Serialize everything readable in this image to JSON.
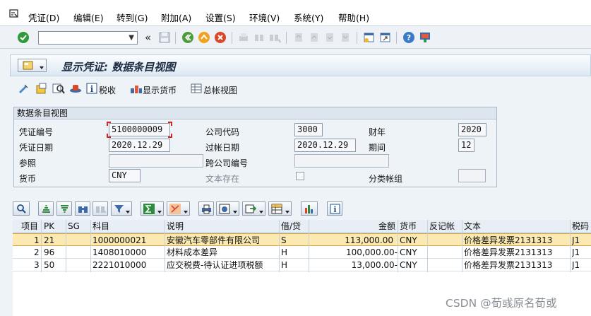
{
  "menu": {
    "items": [
      "凭证(D)",
      "编辑(E)",
      "转到(G)",
      "附加(A)",
      "设置(S)",
      "环境(V)",
      "系统(Y)",
      "帮助(H)"
    ]
  },
  "toolbar": {
    "command_field": "",
    "back_glyph": "«"
  },
  "screen": {
    "title": "显示凭证: 数据条目视图"
  },
  "app_toolbar": {
    "tax_label": "税收",
    "currency_label": "显示货币",
    "general_ledger_label": "总帐视图"
  },
  "header_panel": {
    "title": "数据条目视图",
    "doc_no_label": "凭证编号",
    "doc_no": "5100000009",
    "company_code_label": "公司代码",
    "company_code": "3000",
    "fiscal_year_label": "财年",
    "fiscal_year": "2020",
    "doc_date_label": "凭证日期",
    "doc_date": "2020.12.29",
    "posting_date_label": "过帐日期",
    "posting_date": "2020.12.29",
    "period_label": "期间",
    "period": "12",
    "reference_label": "参照",
    "reference": "",
    "cross_company_label": "跨公司编号",
    "cross_company": "",
    "currency_label": "货币",
    "currency": "CNY",
    "text_exists_label": "文本存在",
    "ledger_group_label": "分类帐组",
    "ledger_group": ""
  },
  "table": {
    "columns": [
      "项目",
      "PK",
      "SG",
      "科目",
      "说明",
      "借/贷",
      "金额",
      "货币",
      "反记帐",
      "文本",
      "税码"
    ],
    "rows": [
      {
        "item": "1",
        "pk": "21",
        "sg": "",
        "account": "1000000021",
        "desc": "安徽汽车零部件有限公司",
        "dc": "S",
        "amount": "113,000.00",
        "currency": "CNY",
        "reversal": "",
        "text": "价格差异发票2131313",
        "tax": "J1"
      },
      {
        "item": "2",
        "pk": "96",
        "sg": "",
        "account": "1408010000",
        "desc": "材料成本差异",
        "dc": "H",
        "amount": "100,000.00-",
        "currency": "CNY",
        "reversal": "",
        "text": "价格差异发票2131313",
        "tax": "J1"
      },
      {
        "item": "3",
        "pk": "50",
        "sg": "",
        "account": "2221010000",
        "desc": "应交税费-待认证进项税额",
        "dc": "H",
        "amount": "13,000.00-",
        "currency": "CNY",
        "reversal": "",
        "text": "价格差异发票2131313",
        "tax": "J1"
      }
    ]
  },
  "watermark": "CSDN @荀彧原名荀或",
  "colors": {
    "accept_green": "#2e9a3c",
    "selected_row": "#fbe9b1",
    "title_text": "#1d2c40"
  }
}
